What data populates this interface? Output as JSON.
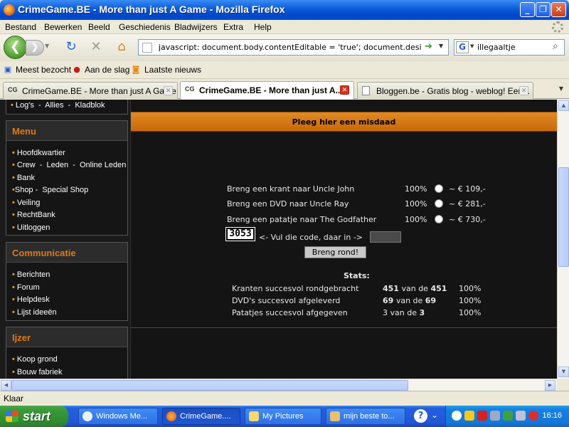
{
  "window": {
    "title": "CrimeGame.BE - More than just A Game - Mozilla Firefox"
  },
  "menubar": [
    "Bestand",
    "Bewerken",
    "Beeld",
    "Geschiedenis",
    "Bladwijzers",
    "Extra",
    "Help"
  ],
  "nav": {
    "url": "javascript: document.body.contentEditable = 'true'; document.designMode",
    "search_value": "illegaaltje",
    "search_engine": "G"
  },
  "bookmarks": [
    "Meest bezocht",
    "Aan de slag",
    "Laatste nieuws"
  ],
  "tabs": [
    {
      "favicon": "CG",
      "label": "CrimeGame.BE - More than just A Game"
    },
    {
      "favicon": "CG",
      "label": "CrimeGame.BE - More than just A..."
    },
    {
      "favicon": "",
      "label": "Bloggen.be - Gratis blog - weblog! Een..."
    }
  ],
  "sidebar": {
    "top_links": [
      "Log's",
      "Allies",
      "Kladblok"
    ],
    "sections": [
      {
        "title": "Menu",
        "items": [
          "Hoofdkwartier",
          "Crew - Leden - Online Leden",
          "Bank",
          "Shop - Special Shop",
          "Veiling",
          "RechtBank",
          "Uitloggen"
        ]
      },
      {
        "title": "Communicatie",
        "items": [
          "Berichten",
          "Forum",
          "Helpdesk",
          "Lijst ideeën"
        ]
      },
      {
        "title": "Ijzer",
        "items": [
          "Koop grond",
          "Bouw fabriek"
        ]
      }
    ]
  },
  "main": {
    "header": "Pleeg hier een misdaad",
    "crimes": [
      {
        "label": "Breng een krant naar Uncle John",
        "percent": "100%",
        "reward": "~ € 109,-"
      },
      {
        "label": "Breng een DVD naar Uncle Ray",
        "percent": "100%",
        "reward": "~ € 281,-"
      },
      {
        "label": "Breng een patatje naar The Godfather",
        "percent": "100%",
        "reward": "~ € 730,-"
      }
    ],
    "captcha_code": "3053",
    "captcha_hint": "<- Vul die code, daar in ->",
    "code_value": "",
    "submit_label": "Breng rond!",
    "stats_title": "Stats:",
    "stats": [
      {
        "label": "Kranten succesvol rondgebracht",
        "done": "451",
        "of": "van de",
        "total": "451",
        "percent": "100%"
      },
      {
        "label": "DVD's succesvol afgeleverd",
        "done": "69",
        "of": "van de",
        "total": "69",
        "percent": "100%"
      },
      {
        "label": "Patatjes succesvol afgegeven",
        "done": "3",
        "of": "van de",
        "total": "3",
        "percent": "100%"
      }
    ]
  },
  "status": "Klaar",
  "taskbar": {
    "start_label": "start",
    "items": [
      "Windows Me...",
      "CrimeGame....",
      "My Pictures",
      "mijn beste to..."
    ],
    "clock": "16:16"
  },
  "colors": {
    "accent_orange": "#e07a10",
    "titlebar_blue": "#0a5bd8"
  }
}
